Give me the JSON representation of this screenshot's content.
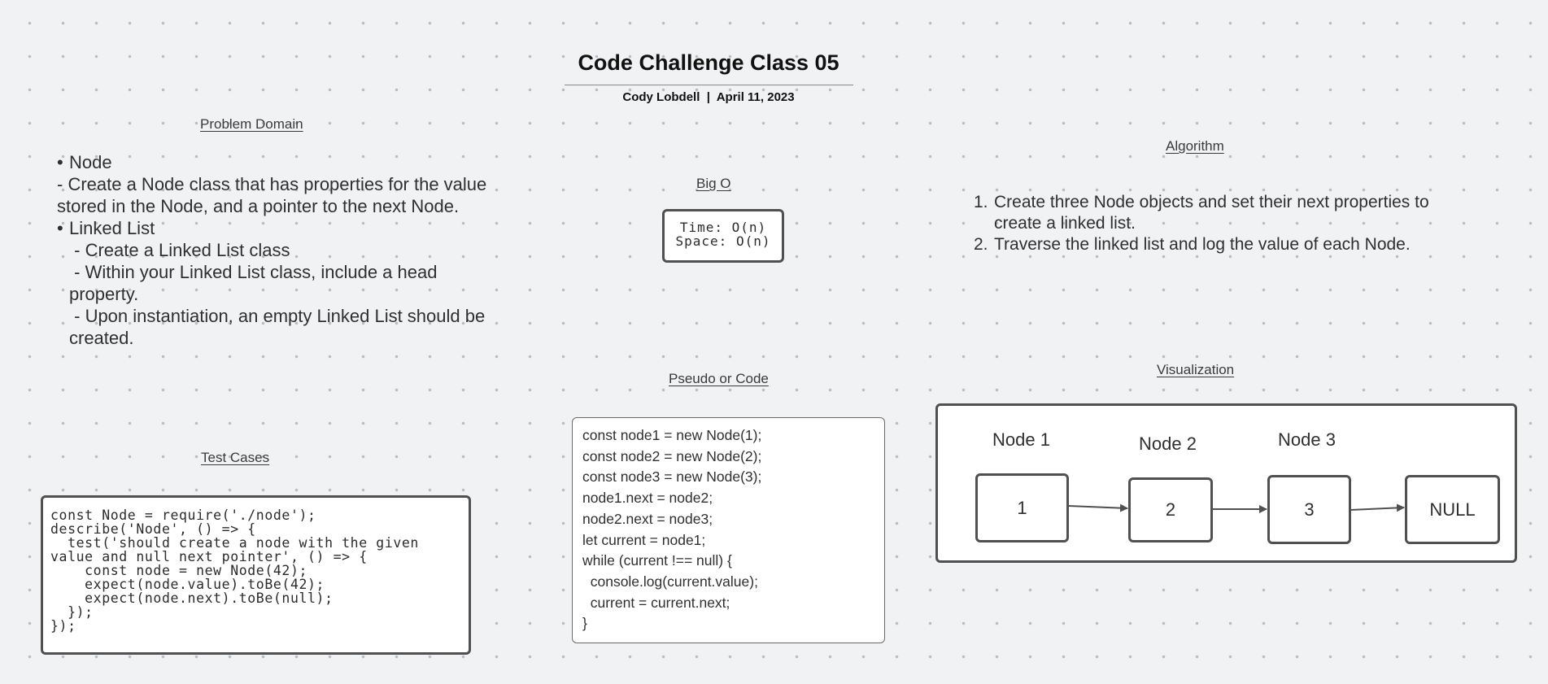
{
  "header": {
    "title": "Code Challenge Class 05",
    "subtitle": "Cody Lobdell  |  April 11, 2023"
  },
  "sections": {
    "problem_domain": "Problem Domain",
    "big_o": "Big O",
    "algorithm": "Algorithm",
    "test_cases": "Test Cases",
    "pseudo": "Pseudo or Code",
    "visualization": "Visualization"
  },
  "problem_domain": {
    "items": [
      {
        "bullet": "Node",
        "lines": [
          "- Create a Node class that has properties for the value stored in the Node, and a pointer to the next Node."
        ]
      },
      {
        "bullet": "Linked List",
        "lines": [
          " - Create a Linked List class",
          " - Within your Linked List class, include a head property.",
          " - Upon instantiation, an empty Linked List should be created."
        ]
      }
    ]
  },
  "big_o": {
    "time": "Time: O(n)",
    "space": "Space: O(n)"
  },
  "algorithm": {
    "steps": [
      {
        "num": "1.",
        "text": " Create three Node objects and set their next properties to create a linked list."
      },
      {
        "num": "2.",
        "text": "Traverse the linked list and log the value of each Node."
      }
    ]
  },
  "test_code": [
    "const Node = require('./node');",
    "describe('Node', () => {",
    "  test('should create a node with the given",
    "value and null next pointer', () => {",
    "    const node = new Node(42);",
    "    expect(node.value).toBe(42);",
    "    expect(node.next).toBe(null);",
    "  });",
    "});"
  ],
  "pseudo_code": [
    "const node1 = new Node(1);",
    "const node2 = new Node(2);",
    "const node3 = new Node(3);",
    "node1.next = node2;",
    "node2.next = node3;",
    "let current = node1;",
    "while (current !== null) {",
    "  console.log(current.value);",
    "  current = current.next;",
    "}"
  ],
  "visualization": {
    "labels": [
      "Node 1",
      "Node 2",
      "Node 3"
    ],
    "nodes": [
      "1",
      "2",
      "3",
      "NULL"
    ]
  },
  "colors": {
    "background": "#f1f2f4",
    "border": "#505050",
    "text": "#2f2f2f"
  }
}
